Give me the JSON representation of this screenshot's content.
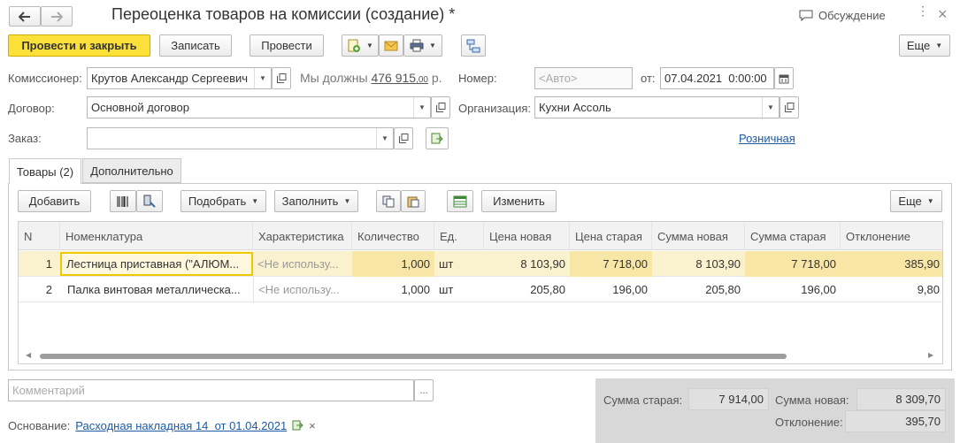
{
  "window": {
    "title": "Переоценка товаров на комиссии (создание) *",
    "discuss_label": "Обсуждение"
  },
  "toolbar": {
    "post_close": "Провести и закрыть",
    "save": "Записать",
    "post": "Провести",
    "more": "Еще"
  },
  "form": {
    "commissioner_label": "Комиссионер:",
    "commissioner_value": "Крутов Александр Сергеевич",
    "debt_label": "Мы должны",
    "debt_amount": "476 915",
    "debt_cents": ",00",
    "debt_unit": "р.",
    "number_label": "Номер:",
    "number_placeholder": "<Авто>",
    "from_label": "от:",
    "date_value": "07.04.2021  0:00:00",
    "contract_label": "Договор:",
    "contract_value": "Основной договор",
    "org_label": "Организация:",
    "org_value": "Кухни Ассоль",
    "order_label": "Заказ:",
    "order_value": "",
    "retail_link": "Розничная"
  },
  "tabs": [
    {
      "label": "Товары (2)"
    },
    {
      "label": "Дополнительно"
    }
  ],
  "table_toolbar": {
    "add": "Добавить",
    "pick": "Подобрать",
    "fill": "Заполнить",
    "change": "Изменить",
    "more": "Еще"
  },
  "table": {
    "headers": [
      "N",
      "Номенклатура",
      "Характеристика",
      "Количество",
      "Ед.",
      "Цена новая",
      "Цена старая",
      "Сумма новая",
      "Сумма старая",
      "Отклонение"
    ],
    "rows": [
      {
        "n": "1",
        "item": "Лестница приставная (\"АЛЮМ...",
        "char": "<Не использу...",
        "qty": "1,000",
        "unit": "шт",
        "price_new": "8 103,90",
        "price_old": "7 718,00",
        "sum_new": "8 103,90",
        "sum_old": "7 718,00",
        "dev": "385,90"
      },
      {
        "n": "2",
        "item": "Палка винтовая металлическа...",
        "char": "<Не использу...",
        "qty": "1,000",
        "unit": "шт",
        "price_new": "205,80",
        "price_old": "196,00",
        "sum_new": "205,80",
        "sum_old": "196,00",
        "dev": "9,80"
      }
    ]
  },
  "comment": {
    "placeholder": "Комментарий",
    "more": "..."
  },
  "basis": {
    "label": "Основание:",
    "link": "Расходная накладная 14  от 01.04.2021",
    "clear": "×"
  },
  "totals": {
    "old_label": "Сумма старая:",
    "old_value": "7 914,00",
    "new_label": "Сумма новая:",
    "new_value": "8 309,70",
    "dev_label": "Отклонение:",
    "dev_value": "395,70"
  }
}
